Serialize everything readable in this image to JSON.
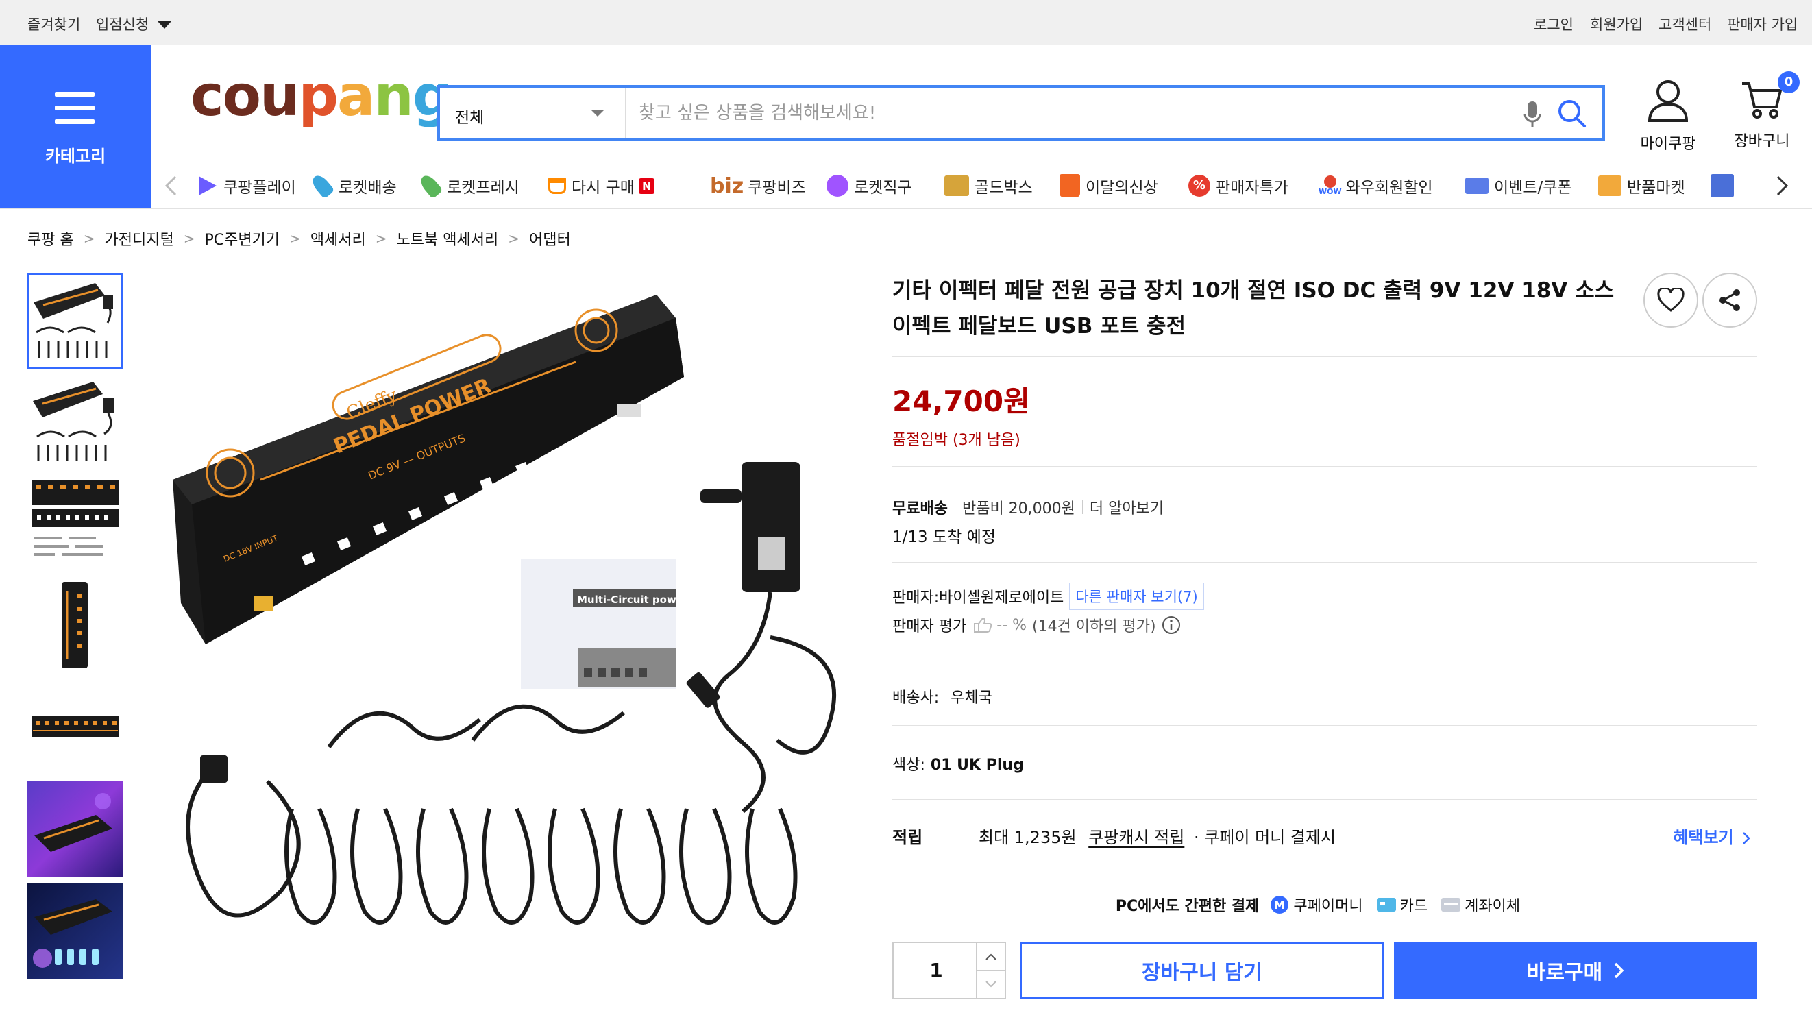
{
  "topbar": {
    "left": [
      "즐겨찾기",
      "입점신청"
    ],
    "right": [
      "로그인",
      "회원가입",
      "고객센터",
      "판매자 가입"
    ]
  },
  "header": {
    "category_label": "카테고리",
    "logo": {
      "c1": "cou",
      "c2": "p",
      "c3": "a",
      "c4": "n",
      "c5": "g"
    },
    "search": {
      "category": "전체",
      "placeholder": "찾고 싶은 상품을 검색해보세요!"
    },
    "mycoupang": "마이쿠팡",
    "cart": "장바구니",
    "cart_count": "0"
  },
  "nav": [
    {
      "label": "쿠팡플레이",
      "color": "#6b5cff"
    },
    {
      "label": "로켓배송",
      "color": "#3aa6dd"
    },
    {
      "label": "로켓프레시",
      "color": "#5ab65a"
    },
    {
      "label": "다시 구매",
      "color": "#ff8a00"
    },
    {
      "label": "쿠팡비즈",
      "color": "#c46a2b"
    },
    {
      "label": "로켓직구",
      "color": "#a054ff"
    },
    {
      "label": "골드박스",
      "color": "#d6a43a"
    },
    {
      "label": "이달의신상",
      "color": "#f26522"
    },
    {
      "label": "판매자특가",
      "color": "#e63b2e"
    },
    {
      "label": "와우회원할인",
      "color": "#e2442f"
    },
    {
      "label": "이벤트/쿠폰",
      "color": "#5a7ce8"
    },
    {
      "label": "반품마켓",
      "color": "#f2a93b"
    }
  ],
  "nav_extra": {
    "n_badge": "N",
    "biz": "biz",
    "wow": "WOW"
  },
  "breadcrumb": [
    "쿠팡 홈",
    "가전디지털",
    "PC주변기기",
    "액세서리",
    "노트북 액세서리",
    "어댑터"
  ],
  "product": {
    "title": "기타 이펙터 페달 전원 공급 장치 10개 절연 ISO DC 출력 9V 12V 18V 소스 이펙트 페달보드 USB 포트 충전",
    "price": "24,700원",
    "stock": "품절임박 (3개 남음)",
    "shipping_free": "무료배송",
    "return_fee": "반품비 20,000원",
    "learn_more": "더 알아보기",
    "arrival": "1/13 도착 예정",
    "seller_label": "판매자:",
    "seller_name": "바이셀원제로에이트",
    "other_sellers": "다른 판매자 보기(7)",
    "rating_label": "판매자 평가",
    "rating_value": "-- %",
    "rating_note": "(14건 이하의 평가)",
    "deliverer_label": "배송사:",
    "deliverer": "우체국",
    "color_label": "색상:",
    "color_value": "01 UK Plug",
    "reward_label": "적립",
    "reward_amount": "최대 1,235원",
    "reward_link": "쿠팡캐시 적립",
    "reward_tail": "· 쿠페이 머니 결제시",
    "benefit_link": "혜택보기",
    "pay_title": "PC에서도 간편한 결제",
    "pay_methods": [
      "쿠페이머니",
      "카드",
      "계좌이체"
    ],
    "quantity": "1",
    "add_cart": "장바구니 담기",
    "buy_now": "바로구매"
  },
  "image_text": {
    "brand": "Cleffy",
    "model": "PEDAL POWER",
    "outputs": "DC 9V — OUTPUTS",
    "input": "DC 18V INPUT",
    "manual": "Multi-Circuit pow"
  },
  "colors": {
    "accent": "#346aff",
    "price": "#ae0000",
    "search_border": "#4285f4"
  }
}
